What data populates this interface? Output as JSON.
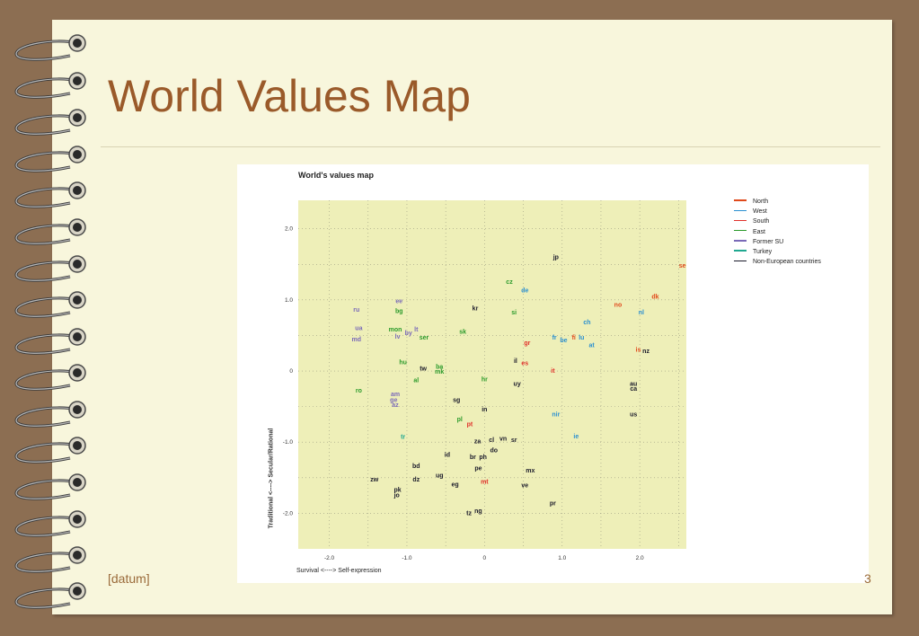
{
  "slide": {
    "title": "World Values Map",
    "footer_left": "[datum]",
    "footer_right": "3"
  },
  "figure": {
    "title": "World's values map",
    "xlabel": "Survival <----> Self-expression",
    "ylabel": "Traditional <----> Secular/Rational"
  },
  "colors": {
    "background": "#8c6e52",
    "paper": "#f8f6dc",
    "title": "#9a5a2a",
    "plot_area": "#eeefb8"
  },
  "chart_data": {
    "type": "scatter",
    "title": "World's values map",
    "xlabel": "Survival <----> Self-expression",
    "ylabel": "Traditional <----> Secular/Rational",
    "xlim": [
      -2.4,
      2.6
    ],
    "ylim": [
      -2.5,
      2.4
    ],
    "xticks": [
      -2.0,
      -1.0,
      0,
      1.0,
      2.0
    ],
    "xtick_labels": [
      "-2.0",
      "-1.0",
      "0",
      "1.0",
      "2.0"
    ],
    "yticks": [
      2.0,
      1.0,
      0,
      -1.0,
      -2.0
    ],
    "ytick_labels": [
      "2.0",
      "1.0",
      "0",
      "-1.0",
      "-2.0"
    ],
    "grid": true,
    "legend_position": "right",
    "groups": [
      {
        "name": "North",
        "color": "#e04a1c"
      },
      {
        "name": "West",
        "color": "#2a8fd0"
      },
      {
        "name": "South",
        "color": "#e0302a"
      },
      {
        "name": "East",
        "color": "#2a9a2a"
      },
      {
        "name": "Former SU",
        "color": "#7a6ab8"
      },
      {
        "name": "Turkey",
        "color": "#20a890"
      },
      {
        "name": "Non-European countries",
        "color": "#1a1a2a"
      }
    ],
    "points": [
      {
        "label": "jp",
        "x": 0.92,
        "y": 1.6,
        "group": "Non-European countries"
      },
      {
        "label": "se",
        "x": 2.55,
        "y": 1.48,
        "group": "North"
      },
      {
        "label": "cz",
        "x": 0.32,
        "y": 1.25,
        "group": "East"
      },
      {
        "label": "de",
        "x": 0.52,
        "y": 1.13,
        "group": "West"
      },
      {
        "label": "dk",
        "x": 2.2,
        "y": 1.04,
        "group": "North"
      },
      {
        "label": "no",
        "x": 1.72,
        "y": 0.93,
        "group": "North"
      },
      {
        "label": "nl",
        "x": 2.02,
        "y": 0.82,
        "group": "West"
      },
      {
        "label": "ee",
        "x": -1.1,
        "y": 0.98,
        "group": "Former SU"
      },
      {
        "label": "ru",
        "x": -1.65,
        "y": 0.86,
        "group": "Former SU"
      },
      {
        "label": "bg",
        "x": -1.1,
        "y": 0.84,
        "group": "East"
      },
      {
        "label": "kr",
        "x": -0.12,
        "y": 0.88,
        "group": "Non-European countries"
      },
      {
        "label": "si",
        "x": 0.38,
        "y": 0.82,
        "group": "East"
      },
      {
        "label": "ch",
        "x": 1.32,
        "y": 0.68,
        "group": "West"
      },
      {
        "label": "ua",
        "x": -1.62,
        "y": 0.6,
        "group": "Former SU"
      },
      {
        "label": "mon",
        "x": -1.15,
        "y": 0.58,
        "group": "East"
      },
      {
        "label": "lt",
        "x": -0.88,
        "y": 0.58,
        "group": "Former SU"
      },
      {
        "label": "sk",
        "x": -0.28,
        "y": 0.55,
        "group": "East"
      },
      {
        "label": "by",
        "x": -0.98,
        "y": 0.53,
        "group": "Former SU"
      },
      {
        "label": "lv",
        "x": -1.12,
        "y": 0.48,
        "group": "Former SU"
      },
      {
        "label": "ser",
        "x": -0.78,
        "y": 0.47,
        "group": "East"
      },
      {
        "label": "md",
        "x": -1.65,
        "y": 0.44,
        "group": "Former SU"
      },
      {
        "label": "fr",
        "x": 0.9,
        "y": 0.47,
        "group": "West"
      },
      {
        "label": "fi",
        "x": 1.15,
        "y": 0.47,
        "group": "North"
      },
      {
        "label": "lu",
        "x": 1.25,
        "y": 0.47,
        "group": "West"
      },
      {
        "label": "be",
        "x": 1.02,
        "y": 0.43,
        "group": "West"
      },
      {
        "label": "gr",
        "x": 0.55,
        "y": 0.39,
        "group": "South"
      },
      {
        "label": "at",
        "x": 1.38,
        "y": 0.36,
        "group": "West"
      },
      {
        "label": "is",
        "x": 1.98,
        "y": 0.3,
        "group": "North"
      },
      {
        "label": "nz",
        "x": 2.08,
        "y": 0.28,
        "group": "Non-European countries"
      },
      {
        "label": "il",
        "x": 0.4,
        "y": 0.14,
        "group": "Non-European countries"
      },
      {
        "label": "es",
        "x": 0.52,
        "y": 0.11,
        "group": "South"
      },
      {
        "label": "hu",
        "x": -1.05,
        "y": 0.12,
        "group": "East"
      },
      {
        "label": "tw",
        "x": -0.79,
        "y": 0.03,
        "group": "Non-European countries"
      },
      {
        "label": "ba",
        "x": -0.58,
        "y": 0.06,
        "group": "East"
      },
      {
        "label": "mk",
        "x": -0.58,
        "y": -0.01,
        "group": "East"
      },
      {
        "label": "it",
        "x": 0.88,
        "y": 0.0,
        "group": "South"
      },
      {
        "label": "al",
        "x": -0.88,
        "y": -0.13,
        "group": "East"
      },
      {
        "label": "hr",
        "x": 0.0,
        "y": -0.12,
        "group": "East"
      },
      {
        "label": "uy",
        "x": 0.42,
        "y": -0.18,
        "group": "Non-European countries"
      },
      {
        "label": "au",
        "x": 1.92,
        "y": -0.18,
        "group": "Non-European countries"
      },
      {
        "label": "ca",
        "x": 1.92,
        "y": -0.25,
        "group": "Non-European countries"
      },
      {
        "label": "ro",
        "x": -1.62,
        "y": -0.28,
        "group": "East"
      },
      {
        "label": "am",
        "x": -1.15,
        "y": -0.33,
        "group": "Former SU"
      },
      {
        "label": "ge",
        "x": -1.17,
        "y": -0.41,
        "group": "Former SU"
      },
      {
        "label": "az",
        "x": -1.15,
        "y": -0.48,
        "group": "Former SU"
      },
      {
        "label": "sg",
        "x": -0.36,
        "y": -0.41,
        "group": "Non-European countries"
      },
      {
        "label": "in",
        "x": 0.0,
        "y": -0.54,
        "group": "Non-European countries"
      },
      {
        "label": "nir",
        "x": 0.92,
        "y": -0.61,
        "group": "West"
      },
      {
        "label": "us",
        "x": 1.92,
        "y": -0.61,
        "group": "Non-European countries"
      },
      {
        "label": "pl",
        "x": -0.32,
        "y": -0.68,
        "group": "East"
      },
      {
        "label": "pt",
        "x": -0.19,
        "y": -0.75,
        "group": "South"
      },
      {
        "label": "tr",
        "x": -1.05,
        "y": -0.93,
        "group": "Turkey"
      },
      {
        "label": "ie",
        "x": 1.18,
        "y": -0.92,
        "group": "West"
      },
      {
        "label": "za",
        "x": -0.09,
        "y": -0.99,
        "group": "Non-European countries"
      },
      {
        "label": "cl",
        "x": 0.09,
        "y": -0.97,
        "group": "Non-European countries"
      },
      {
        "label": "vn",
        "x": 0.24,
        "y": -0.95,
        "group": "Non-European countries"
      },
      {
        "label": "sr",
        "x": 0.38,
        "y": -0.97,
        "group": "Non-European countries"
      },
      {
        "label": "do",
        "x": 0.12,
        "y": -1.12,
        "group": "Non-European countries"
      },
      {
        "label": "id",
        "x": -0.48,
        "y": -1.18,
        "group": "Non-European countries"
      },
      {
        "label": "br",
        "x": -0.15,
        "y": -1.21,
        "group": "Non-European countries"
      },
      {
        "label": "ph",
        "x": -0.02,
        "y": -1.21,
        "group": "Non-European countries"
      },
      {
        "label": "bd",
        "x": -0.88,
        "y": -1.34,
        "group": "Non-European countries"
      },
      {
        "label": "pe",
        "x": -0.08,
        "y": -1.37,
        "group": "Non-European countries"
      },
      {
        "label": "mx",
        "x": 0.59,
        "y": -1.4,
        "group": "Non-European countries"
      },
      {
        "label": "ug",
        "x": -0.58,
        "y": -1.47,
        "group": "Non-European countries"
      },
      {
        "label": "zw",
        "x": -1.42,
        "y": -1.53,
        "group": "Non-European countries"
      },
      {
        "label": "dz",
        "x": -0.88,
        "y": -1.53,
        "group": "Non-European countries"
      },
      {
        "label": "mt",
        "x": 0.0,
        "y": -1.56,
        "group": "South"
      },
      {
        "label": "eg",
        "x": -0.38,
        "y": -1.6,
        "group": "Non-European countries"
      },
      {
        "label": "ve",
        "x": 0.52,
        "y": -1.61,
        "group": "Non-European countries"
      },
      {
        "label": "pk",
        "x": -1.12,
        "y": -1.67,
        "group": "Non-European countries"
      },
      {
        "label": "jo",
        "x": -1.13,
        "y": -1.75,
        "group": "Non-European countries"
      },
      {
        "label": "pr",
        "x": 0.88,
        "y": -1.86,
        "group": "Non-European countries"
      },
      {
        "label": "ng",
        "x": -0.08,
        "y": -1.97,
        "group": "Non-European countries"
      },
      {
        "label": "tz",
        "x": -0.2,
        "y": -2.0,
        "group": "Non-European countries"
      }
    ]
  }
}
